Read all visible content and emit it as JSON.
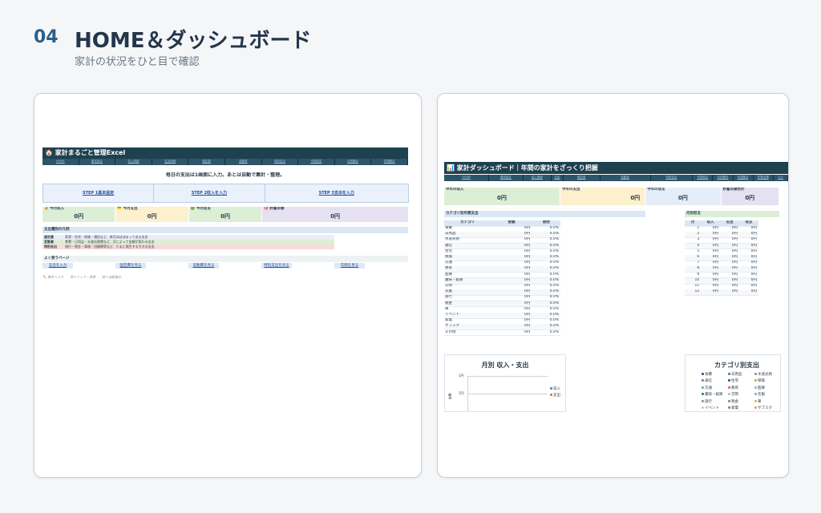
{
  "header": {
    "number": "04",
    "title": "HOME＆ダッシュボード",
    "subtitle": "家計の状況をひと目で確認"
  },
  "home": {
    "title": "🏠 家計まるごと管理Excel",
    "tabs": [
      "HOME",
      "基本設定",
      "収入明細",
      "支出明細",
      "固定費",
      "変動費",
      "特別支出",
      "予算設定",
      "月別集計",
      "年間集計"
    ],
    "message": "毎日の支出は1画面に入力。あとは自動で集計・整理。",
    "steps": [
      "STEP 1基本設定",
      "STEP 2収入を入力",
      "STEP 3支出を入力"
    ],
    "metrics": [
      {
        "label": "💰 今月収入",
        "value": "0円",
        "bg": "#dcefd6"
      },
      {
        "label": "💳 今月支出",
        "value": "0円",
        "bg": "#fdf0cc"
      },
      {
        "label": "🟢 今月収支",
        "value": "0円",
        "bg": "#dcefd6"
      },
      {
        "label": "🎯 貯蓄目標",
        "value": "0円",
        "bg": "#e6e0f3"
      }
    ],
    "legend_title": "支出種別の凡例",
    "legend": [
      {
        "key": "固定費",
        "desc": "家賃・住宅・保険・通信など、毎月ほぼ決まって出る支出",
        "bg": "#e8eef6"
      },
      {
        "key": "変動費",
        "desc": "食費・日用品・水道光熱費など、月によって金額が変わる支出",
        "bg": "#dcefd6"
      },
      {
        "key": "特別支出",
        "desc": "旅行・税金・車検・冠婚葬祭など、たまに発生する大きな支出",
        "bg": "#f9dada"
      }
    ],
    "quick_title": "よく使うページ",
    "quick_links": [
      "支出を入力",
      "固定費を見る",
      "変動費を見る",
      "特別支出を見る",
      "年間を見る"
    ],
    "note": "✏️ 黄色＝入力　　青＝リンク・参照　　緑＝自動集計"
  },
  "dashboard": {
    "title": "📊 家計ダッシュボード｜年間の家計をざっくり把握",
    "tabs": [
      "HOME",
      "基本設定",
      "収入明細",
      "支出",
      "固定費",
      "変動費",
      "特別支出",
      "予算設定",
      "月別集計",
      "年間集計",
      "貯蓄目標",
      "メモ"
    ],
    "kpis": [
      {
        "label": "今年の収入",
        "value": "0円",
        "bg": "#dcefd6"
      },
      {
        "label": "今年の支出",
        "value": "0円",
        "bg": "#fdf0cc"
      },
      {
        "label": "今年の収支",
        "value": "0円",
        "bg": "#e3eef8"
      },
      {
        "label": "貯蓄目標合計",
        "value": "0円",
        "bg": "#e6e0f3"
      }
    ],
    "category_section": "カテゴリ別年間支出",
    "category_headers": [
      "カテゴリ",
      "金額",
      "割合"
    ],
    "categories": [
      [
        "食費",
        "0円",
        "0.0%"
      ],
      [
        "日用品",
        "0円",
        "0.0%"
      ],
      [
        "水道光熱",
        "0円",
        "0.0%"
      ],
      [
        "通信",
        "0円",
        "0.0%"
      ],
      [
        "住宅",
        "0円",
        "0.0%"
      ],
      [
        "保険",
        "0円",
        "0.0%"
      ],
      [
        "交通",
        "0円",
        "0.0%"
      ],
      [
        "教育",
        "0円",
        "0.0%"
      ],
      [
        "医療",
        "0円",
        "0.0%"
      ],
      [
        "趣味・娯楽",
        "0円",
        "0.0%"
      ],
      [
        "交際",
        "0円",
        "0.0%"
      ],
      [
        "衣服",
        "0円",
        "0.0%"
      ],
      [
        "旅行",
        "0円",
        "0.0%"
      ],
      [
        "税金",
        "0円",
        "0.0%"
      ],
      [
        "車",
        "0円",
        "0.0%"
      ],
      [
        "イベント",
        "0円",
        "0.0%"
      ],
      [
        "家電",
        "0円",
        "0.0%"
      ],
      [
        "サブスク",
        "0円",
        "0.0%"
      ],
      [
        "その他",
        "0円",
        "0.0%"
      ]
    ],
    "monthly_section": "月別収支",
    "monthly_headers": [
      "月",
      "収入",
      "支出",
      "収支"
    ],
    "months": [
      [
        "1",
        "0円",
        "0円",
        "0円"
      ],
      [
        "2",
        "0円",
        "0円",
        "0円"
      ],
      [
        "3",
        "0円",
        "0円",
        "0円"
      ],
      [
        "4",
        "0円",
        "0円",
        "0円"
      ],
      [
        "5",
        "0円",
        "0円",
        "0円"
      ],
      [
        "6",
        "0円",
        "0円",
        "0円"
      ],
      [
        "7",
        "0円",
        "0円",
        "0円"
      ],
      [
        "8",
        "0円",
        "0円",
        "0円"
      ],
      [
        "9",
        "0円",
        "0円",
        "0円"
      ],
      [
        "10",
        "0円",
        "0円",
        "0円"
      ],
      [
        "11",
        "0円",
        "0円",
        "0円"
      ],
      [
        "12",
        "0円",
        "0円",
        "0円"
      ]
    ],
    "chart1": {
      "title": "月別 収入・支出",
      "ylabel": "金額",
      "ticks": [
        "1円",
        "1円"
      ],
      "legend": [
        {
          "name": "収入",
          "color": "#4a7fb5"
        },
        {
          "name": "支出",
          "color": "#d0624c"
        }
      ]
    },
    "chart2": {
      "title": "カテゴリ別支出",
      "legend": [
        {
          "name": "食費",
          "color": "#33495e"
        },
        {
          "name": "日用品",
          "color": "#4f6b8a"
        },
        {
          "name": "水道光熱",
          "color": "#7a8fa5"
        },
        {
          "name": "通信",
          "color": "#5b7ea6"
        },
        {
          "name": "住宅",
          "color": "#2e4d6b"
        },
        {
          "name": "保険",
          "color": "#c89a5a"
        },
        {
          "name": "交通",
          "color": "#6b9ac4"
        },
        {
          "name": "教育",
          "color": "#d0624c"
        },
        {
          "name": "医療",
          "color": "#8bb0d3"
        },
        {
          "name": "趣味・娯楽",
          "color": "#3d6b52"
        },
        {
          "name": "交際",
          "color": "#a3bfd9"
        },
        {
          "name": "衣服",
          "color": "#b38bc2"
        },
        {
          "name": "旅行",
          "color": "#6e9b7e"
        },
        {
          "name": "税金",
          "color": "#9d7a55"
        },
        {
          "name": "車",
          "color": "#d9b24c"
        },
        {
          "name": "イベント",
          "color": "#c2c8ce"
        },
        {
          "name": "家電",
          "color": "#6f7d8a"
        },
        {
          "name": "サブスク",
          "color": "#e09a7a"
        }
      ]
    }
  }
}
